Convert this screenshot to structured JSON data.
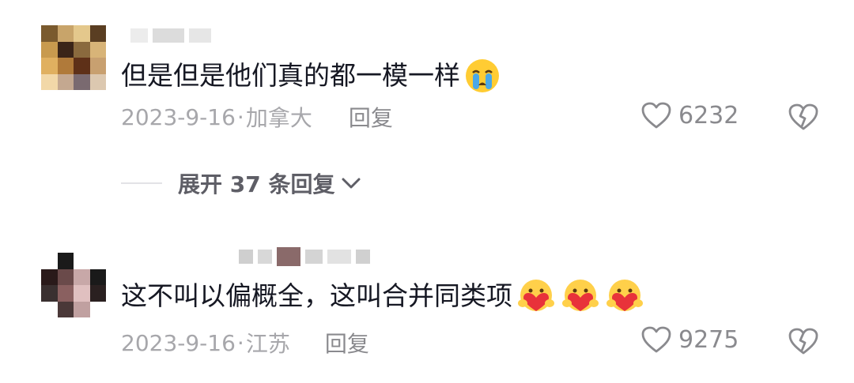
{
  "comments": [
    {
      "text": "但是但是他们真的都一模一样",
      "emoji": "crying-emoji",
      "date": "2023-9-16",
      "location": "加拿大",
      "reply_label": "回复",
      "likes": "6232",
      "avatar_colors": [
        "#7a5a2e",
        "#c8a46a",
        "#e4c88c",
        "#5a3e22",
        "#c89a4e",
        "#3a2418",
        "#8a6a3e",
        "#d8b478",
        "#e0b060",
        "#b07a3a",
        "#5e3018",
        "#c8a070",
        "#f2d8a8",
        "#c4a890",
        "#7a6a70",
        "#dcc8b0"
      ]
    },
    {
      "text": "这不叫以偏概全，这叫合并同类项",
      "emoji": "heart-hug-emoji",
      "emoji_count": 3,
      "date": "2023-9-16",
      "location": "江苏",
      "reply_label": "回复",
      "likes": "9275",
      "avatar_colors": [
        "#ffffff",
        "#1a1a1a",
        "#ffffff",
        "#ffffff",
        "#2a1a1a",
        "#6a4a4a",
        "#c8a8a8",
        "#1a1a1a",
        "#3a3030",
        "#8a6060",
        "#e0c0c0",
        "#2a2020",
        "#ffffff",
        "#4a3838",
        "#c0a0a0",
        "#ffffff"
      ]
    }
  ],
  "expand_replies": {
    "label": "展开 37 条回复"
  },
  "colors": {
    "text": "#161823",
    "meta": "#a7a7ab",
    "reply": "#8a8a8e",
    "expand": "#5e5e66"
  }
}
